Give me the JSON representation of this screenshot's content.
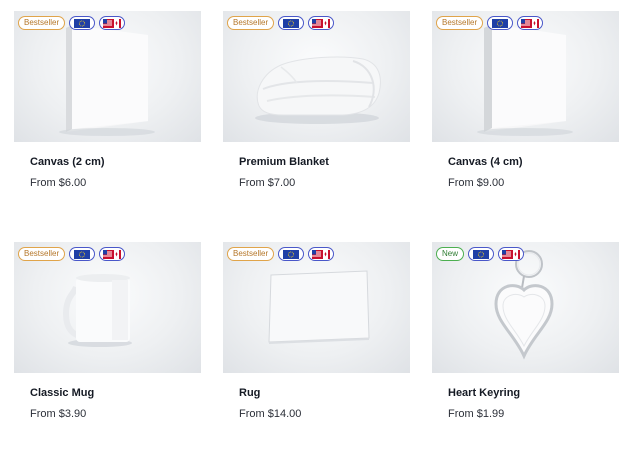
{
  "products": [
    {
      "title": "Canvas (2 cm)",
      "price": "From $6.00",
      "badge": "Bestseller",
      "badge_type": "bestseller",
      "image": "canvas-icon"
    },
    {
      "title": "Premium Blanket",
      "price": "From $7.00",
      "badge": "Bestseller",
      "badge_type": "bestseller",
      "image": "blanket-icon"
    },
    {
      "title": "Canvas (4 cm)",
      "price": "From $9.00",
      "badge": "Bestseller",
      "badge_type": "bestseller",
      "image": "canvas-icon"
    },
    {
      "title": "Classic Mug",
      "price": "From $3.90",
      "badge": "Bestseller",
      "badge_type": "bestseller",
      "image": "mug-icon"
    },
    {
      "title": "Rug",
      "price": "From $14.00",
      "badge": "Bestseller",
      "badge_type": "bestseller",
      "image": "rug-icon"
    },
    {
      "title": "Heart Keyring",
      "price": "From $1.99",
      "badge": "New",
      "badge_type": "new",
      "image": "keyring-icon"
    }
  ],
  "colors": {
    "bestseller_border": "#e0a44a",
    "new_border": "#4caf50",
    "flag_border": "#4957c9",
    "eu_blue": "#1f3fa6",
    "us_red": "#c8102e"
  }
}
